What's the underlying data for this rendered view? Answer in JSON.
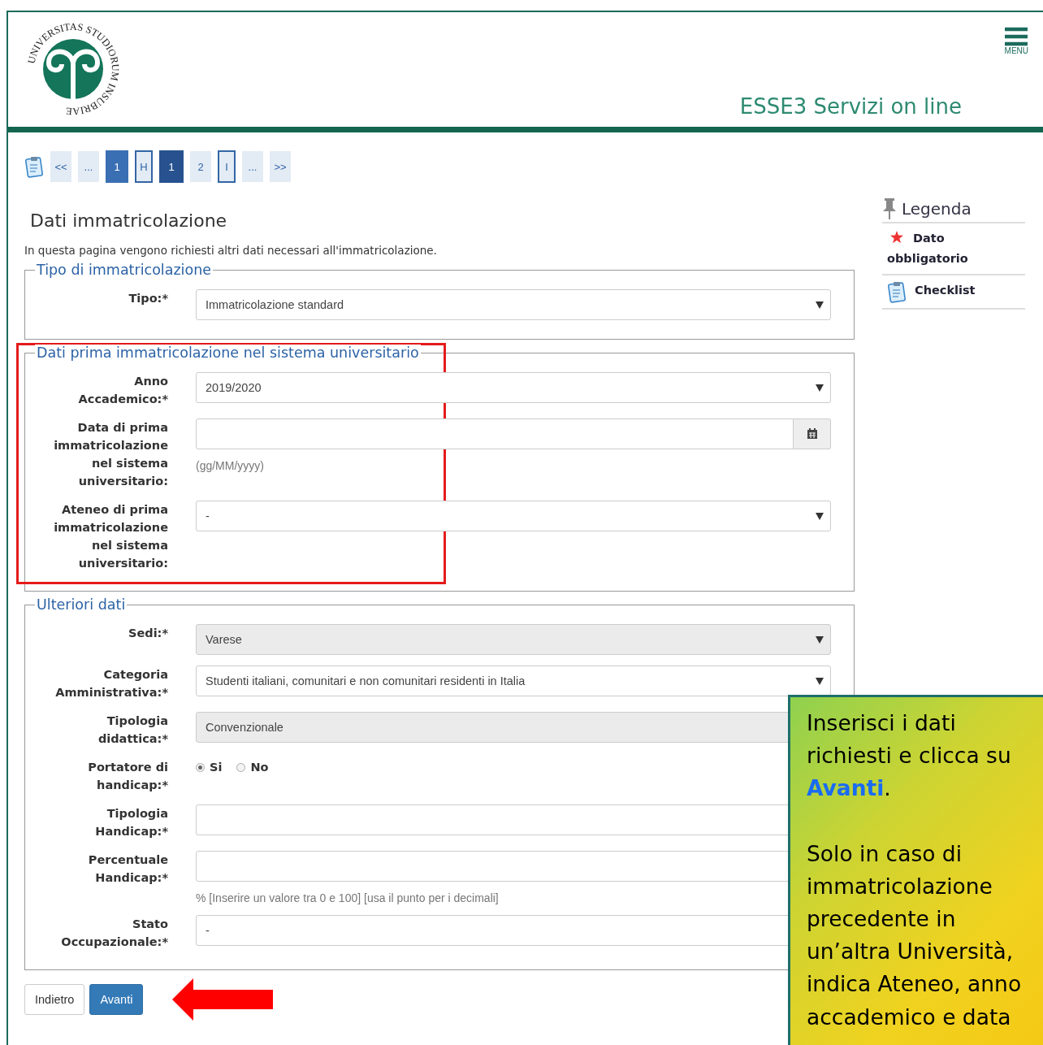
{
  "header": {
    "logo_text": "UNIVERSITAS STUDIORUM INSUBRIAE",
    "menu_label": "MENU",
    "title": "ESSE3 Servizi on line"
  },
  "pagination": [
    {
      "label": "<<",
      "kind": "plain"
    },
    {
      "label": "...",
      "kind": "plain"
    },
    {
      "label": "1",
      "kind": "filled"
    },
    {
      "label": "H",
      "kind": "outlined"
    },
    {
      "label": "1",
      "kind": "filled-dark"
    },
    {
      "label": "2",
      "kind": "plain"
    },
    {
      "label": "I",
      "kind": "outlined"
    },
    {
      "label": "...",
      "kind": "plain"
    },
    {
      "label": ">>",
      "kind": "plain"
    }
  ],
  "page": {
    "title": "Dati immatricolazione",
    "intro": "In questa pagina vengono richiesti altri dati necessari all'immatricolazione."
  },
  "sections": [
    {
      "legend": "Tipo di immatricolazione",
      "highlighted": false,
      "fields": [
        {
          "label": "Tipo:*",
          "kind": "select",
          "value": "Immatricolazione standard",
          "disabled": false
        }
      ]
    },
    {
      "legend": "Dati prima immatricolazione nel sistema universitario",
      "highlighted": true,
      "fields": [
        {
          "label": "Anno Accademico:*",
          "kind": "select",
          "value": "2019/2020",
          "disabled": false
        },
        {
          "label": "Data di prima immatricolazione nel sistema universitario:",
          "kind": "date",
          "hint": "(gg/MM/yyyy)",
          "disabled": false
        },
        {
          "label": "Ateneo di prima immatricolazione nel sistema universitario:",
          "kind": "select",
          "value": "-",
          "disabled": false
        }
      ]
    },
    {
      "legend": "Ulteriori dati",
      "highlighted": false,
      "fields": [
        {
          "label": "Sedi:*",
          "kind": "select",
          "value": "Varese",
          "disabled": true
        },
        {
          "label": "Categoria Amministrativa:*",
          "kind": "select",
          "value": "Studenti italiani, comunitari e non comunitari residenti in Italia",
          "disabled": false
        },
        {
          "label": "Tipologia didattica:*",
          "kind": "select",
          "value": "Convenzionale",
          "disabled": true
        },
        {
          "label": "Portatore di handicap:*",
          "kind": "radio",
          "options": [
            {
              "label": "Si",
              "selected": true
            },
            {
              "label": "No",
              "selected": false
            }
          ]
        },
        {
          "label": "Tipologia Handicap:*",
          "kind": "text",
          "disabled": false
        },
        {
          "label": "Percentuale Handicap:*",
          "kind": "text",
          "hint": "% [Inserire un valore tra 0 e 100] [usa il punto per i decimali]",
          "disabled": false
        },
        {
          "label": "Stato Occupazionale:*",
          "kind": "select",
          "value": "-",
          "disabled": false
        }
      ]
    }
  ],
  "buttons": [
    {
      "label": "Indietro",
      "primary": false
    },
    {
      "label": "Avanti",
      "primary": true
    }
  ],
  "legend": {
    "title": "Legenda",
    "items": [
      {
        "kind": "required",
        "label": "Dato obbligatorio"
      },
      {
        "kind": "checklist",
        "label": "Checklist"
      }
    ]
  },
  "callout": {
    "paragraphs": [
      [
        "Inserisci i dati",
        "richiesti e clicca su",
        "**Avanti**."
      ],
      [
        "Solo in caso di",
        "immatricolazione",
        "precedente in",
        "un’altra Università,",
        "indica Ateneo, anno",
        "accademico e data"
      ]
    ]
  }
}
